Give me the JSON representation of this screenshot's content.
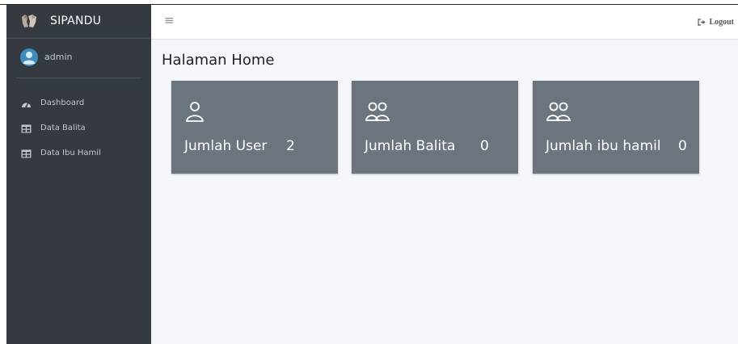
{
  "brand": {
    "name": "SIPANDU"
  },
  "user": {
    "name": "admin"
  },
  "sidebar": {
    "items": [
      {
        "label": "Dashboard",
        "icon": "dashboard-gauge-icon"
      },
      {
        "label": "Data Balita",
        "icon": "table-icon"
      },
      {
        "label": "Data Ibu Hamil",
        "icon": "table-icon"
      }
    ]
  },
  "topbar": {
    "menu_icon": "≡",
    "logout_label": "Logout"
  },
  "main": {
    "title": "Halaman Home",
    "cards": [
      {
        "label": "Jumlah User",
        "count": "2",
        "icon": "user-icon"
      },
      {
        "label": "Jumlah Balita",
        "count": "0",
        "icon": "users-icon"
      },
      {
        "label": "Jumlah ibu hamil",
        "count": "0",
        "icon": "users-icon"
      }
    ]
  },
  "colors": {
    "sidebar_bg": "#343a40",
    "card_bg": "#6c757d",
    "content_bg": "#f4f6f9",
    "avatar_blue": "#3c8dbc"
  }
}
